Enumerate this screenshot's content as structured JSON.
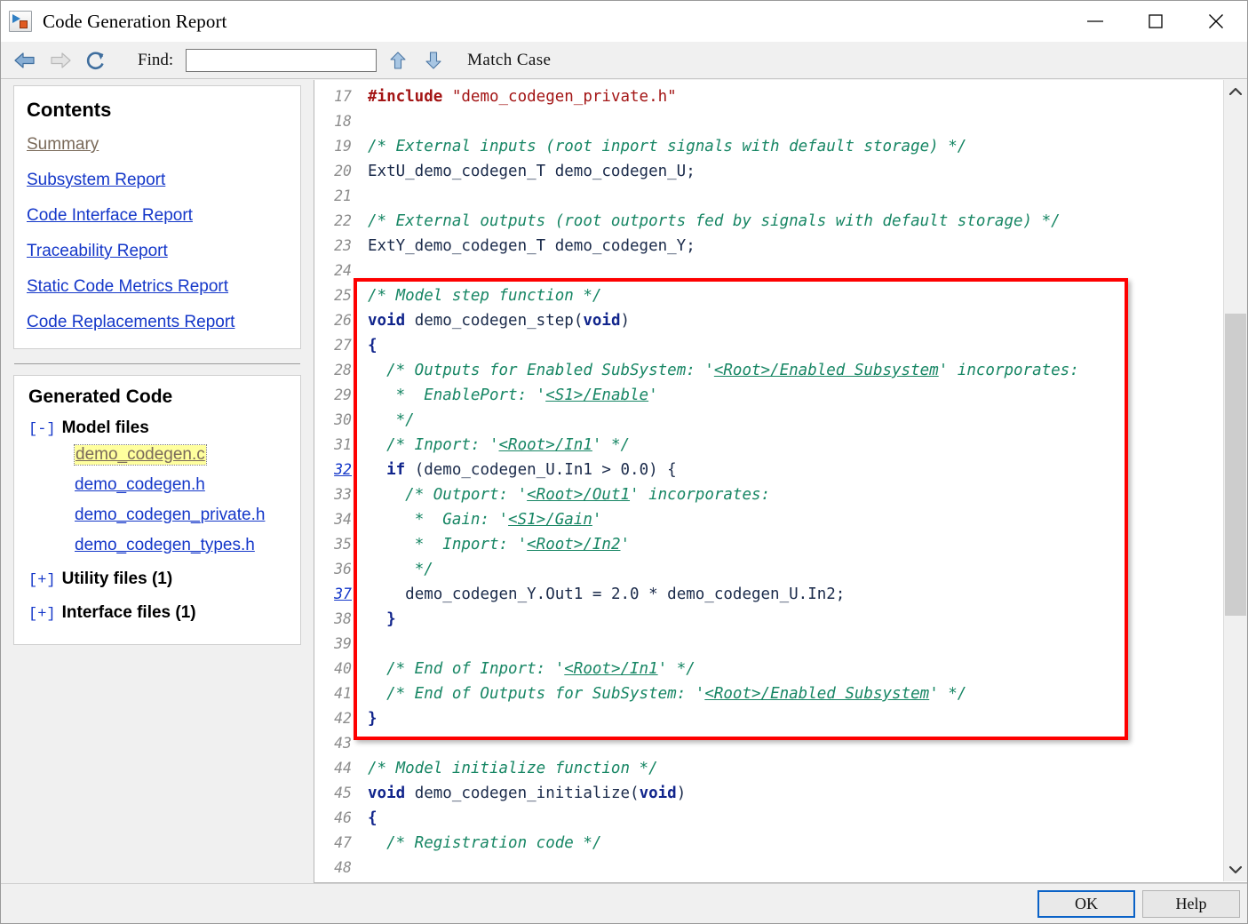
{
  "window": {
    "title": "Code Generation Report",
    "app_icon": "simulink-icon",
    "minimize_label": "minimize-icon",
    "maximize_label": "maximize-icon",
    "close_label": "close-icon"
  },
  "toolbar": {
    "back_icon": "back-arrow-icon",
    "forward_icon": "forward-arrow-icon",
    "refresh_icon": "refresh-icon",
    "find_label": "Find:",
    "find_value": "",
    "find_placeholder": "",
    "find_prev_icon": "arrow-up-icon",
    "find_next_icon": "arrow-down-icon",
    "match_case_label": "Match Case"
  },
  "sidebar": {
    "contents_title": "Contents",
    "toc": [
      {
        "label": "Summary",
        "state": "visited"
      },
      {
        "label": "Subsystem Report",
        "state": "link"
      },
      {
        "label": "Code Interface Report",
        "state": "link"
      },
      {
        "label": "Traceability Report",
        "state": "link"
      },
      {
        "label": "Static Code Metrics Report",
        "state": "link"
      },
      {
        "label": "Code Replacements Report",
        "state": "link"
      }
    ],
    "generated_code_title": "Generated Code",
    "groups": [
      {
        "twisty": "[-]",
        "label": "Model files",
        "files": [
          {
            "name": "demo_codegen.c",
            "selected": true
          },
          {
            "name": "demo_codegen.h",
            "selected": false
          },
          {
            "name": "demo_codegen_private.h",
            "selected": false
          },
          {
            "name": "demo_codegen_types.h",
            "selected": false
          }
        ]
      },
      {
        "twisty": "[+]",
        "label": "Utility files (1)",
        "files": []
      },
      {
        "twisty": "[+]",
        "label": "Interface files (1)",
        "files": []
      }
    ]
  },
  "code": {
    "file": "demo_codegen.c",
    "first_line": 17,
    "last_line": 48,
    "highlight_box": true,
    "lines": [
      {
        "n": 17,
        "trace": false,
        "html": "<span class=\"pre\">#include</span> <span class=\"str\">\"demo_codegen_private.h\"</span>"
      },
      {
        "n": 18,
        "trace": false,
        "html": ""
      },
      {
        "n": 19,
        "trace": false,
        "html": "<span class=\"cm\">/* External inputs (root inport signals with default storage) */</span>"
      },
      {
        "n": 20,
        "trace": false,
        "html": "<span class=\"id\">ExtU_demo_codegen_T demo_codegen_U;</span>"
      },
      {
        "n": 21,
        "trace": false,
        "html": ""
      },
      {
        "n": 22,
        "trace": false,
        "html": "<span class=\"cm\">/* External outputs (root outports fed by signals with default storage) */</span>"
      },
      {
        "n": 23,
        "trace": false,
        "html": "<span class=\"id\">ExtY_demo_codegen_T demo_codegen_Y;</span>"
      },
      {
        "n": 24,
        "trace": false,
        "html": ""
      },
      {
        "n": 25,
        "trace": false,
        "html": "<span class=\"cm\">/* Model step function */</span>"
      },
      {
        "n": 26,
        "trace": false,
        "html": "<span class=\"kw\">void</span> <span class=\"id\">demo_codegen_step(</span><span class=\"kw\">void</span><span class=\"id\">)</span>"
      },
      {
        "n": 27,
        "trace": false,
        "html": "<span class=\"kw\">{</span>"
      },
      {
        "n": 28,
        "trace": false,
        "html": "  <span class=\"cm\">/* Outputs for Enabled SubSystem: '</span><span class=\"lnk\">&lt;Root&gt;/Enabled Subsystem</span><span class=\"cm\">' incorporates:</span>"
      },
      {
        "n": 29,
        "trace": false,
        "html": "   <span class=\"cm\">*  EnablePort: '</span><span class=\"lnk\">&lt;S1&gt;/Enable</span><span class=\"cm\">'</span>"
      },
      {
        "n": 30,
        "trace": false,
        "html": "   <span class=\"cm\">*/</span>"
      },
      {
        "n": 31,
        "trace": false,
        "html": "  <span class=\"cm\">/* Inport: '</span><span class=\"lnk\">&lt;Root&gt;/In1</span><span class=\"cm\">' */</span>"
      },
      {
        "n": 32,
        "trace": true,
        "html": "  <span class=\"kw\">if</span> <span class=\"id\">(demo_codegen_U.In1 &gt; 0.0) {</span>"
      },
      {
        "n": 33,
        "trace": false,
        "html": "    <span class=\"cm\">/* Outport: '</span><span class=\"lnk\">&lt;Root&gt;/Out1</span><span class=\"cm\">' incorporates:</span>"
      },
      {
        "n": 34,
        "trace": false,
        "html": "     <span class=\"cm\">*  Gain: '</span><span class=\"lnk\">&lt;S1&gt;/Gain</span><span class=\"cm\">'</span>"
      },
      {
        "n": 35,
        "trace": false,
        "html": "     <span class=\"cm\">*  Inport: '</span><span class=\"lnk\">&lt;Root&gt;/In2</span><span class=\"cm\">'</span>"
      },
      {
        "n": 36,
        "trace": false,
        "html": "     <span class=\"cm\">*/</span>"
      },
      {
        "n": 37,
        "trace": true,
        "html": "    <span class=\"id\">demo_codegen_Y.Out1 = 2.0 * demo_codegen_U.In2;</span>"
      },
      {
        "n": 38,
        "trace": false,
        "html": "  <span class=\"kw\">}</span>"
      },
      {
        "n": 39,
        "trace": false,
        "html": ""
      },
      {
        "n": 40,
        "trace": false,
        "html": "  <span class=\"cm\">/* End of Inport: '</span><span class=\"lnk\">&lt;Root&gt;/In1</span><span class=\"cm\">' */</span>"
      },
      {
        "n": 41,
        "trace": false,
        "html": "  <span class=\"cm\">/* End of Outputs for SubSystem: '</span><span class=\"lnk\">&lt;Root&gt;/Enabled Subsystem</span><span class=\"cm\">' */</span>"
      },
      {
        "n": 42,
        "trace": false,
        "html": "<span class=\"kw\">}</span>"
      },
      {
        "n": 43,
        "trace": false,
        "html": ""
      },
      {
        "n": 44,
        "trace": false,
        "html": "<span class=\"cm\">/* Model initialize function */</span>"
      },
      {
        "n": 45,
        "trace": false,
        "html": "<span class=\"kw\">void</span> <span class=\"id\">demo_codegen_initialize(</span><span class=\"kw\">void</span><span class=\"id\">)</span>"
      },
      {
        "n": 46,
        "trace": false,
        "html": "<span class=\"kw\">{</span>"
      },
      {
        "n": 47,
        "trace": false,
        "html": "  <span class=\"cm\">/* Registration code */</span>"
      },
      {
        "n": 48,
        "trace": false,
        "html": ""
      }
    ]
  },
  "scrollbar": {
    "up_icon": "chevron-up-icon",
    "down_icon": "chevron-down-icon"
  },
  "footer": {
    "ok_label": "OK",
    "help_label": "Help"
  },
  "colors": {
    "link": "#1437c9",
    "visited": "#7a6a5a",
    "comment": "#178664",
    "keyword": "#11258c",
    "string": "#a31515",
    "highlight_box": "#fe0000",
    "selection_bg": "#ffff9e",
    "focus_border": "#0a62c7"
  }
}
